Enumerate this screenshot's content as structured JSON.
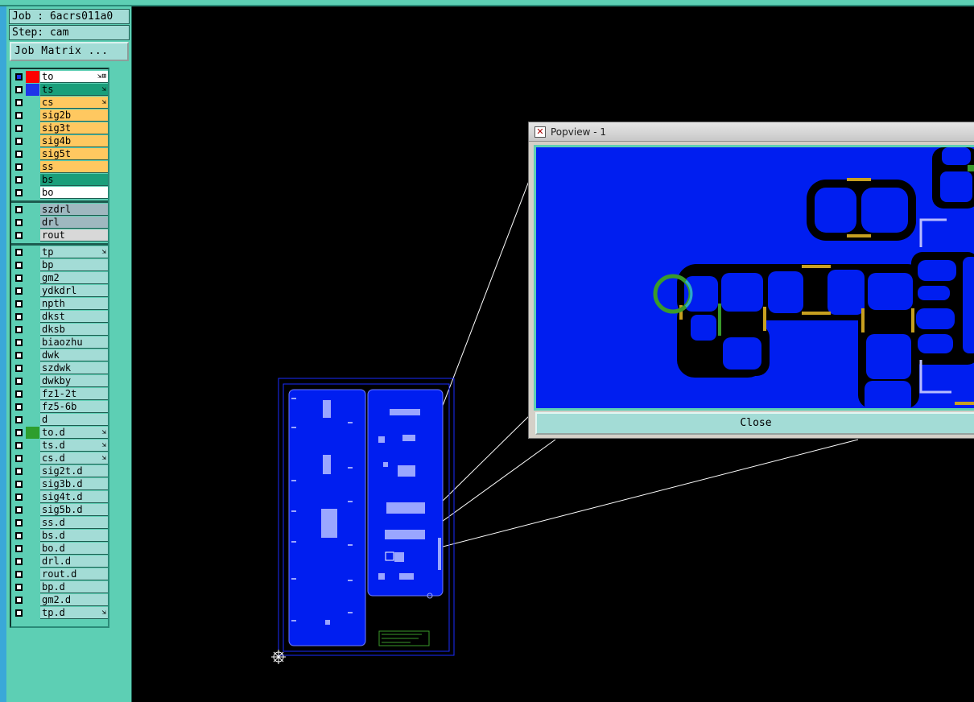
{
  "header": {
    "job_label": "Job : 6acrs011a0",
    "step_label": "Step: cam",
    "job_matrix_label": "Job Matrix ..."
  },
  "layers": [
    {
      "name": "to",
      "color": "#ffffff",
      "swatch": "#ff0000",
      "mark": "⇲⊞",
      "group": 1
    },
    {
      "name": "ts",
      "color": "#1a9e7a",
      "swatch": "#1f34e8",
      "mark": "⇲",
      "group": 1
    },
    {
      "name": "cs",
      "color": "#ffc860",
      "swatch": "",
      "mark": "⇲",
      "group": 1
    },
    {
      "name": "sig2b",
      "color": "#ffc860",
      "swatch": "",
      "mark": "",
      "group": 1
    },
    {
      "name": "sig3t",
      "color": "#ffc860",
      "swatch": "",
      "mark": "",
      "group": 1
    },
    {
      "name": "sig4b",
      "color": "#ffc860",
      "swatch": "",
      "mark": "",
      "group": 1
    },
    {
      "name": "sig5t",
      "color": "#ffc860",
      "swatch": "",
      "mark": "",
      "group": 1
    },
    {
      "name": "ss",
      "color": "#ffc860",
      "swatch": "",
      "mark": "",
      "group": 1
    },
    {
      "name": "bs",
      "color": "#1a9e7a",
      "swatch": "",
      "mark": "",
      "group": 1
    },
    {
      "name": "bo",
      "color": "#ffffff",
      "swatch": "",
      "mark": "",
      "group": 1
    },
    {
      "name": "szdrl",
      "color": "#9fb8c0",
      "swatch": "",
      "mark": "",
      "group": 2
    },
    {
      "name": "drl",
      "color": "#9fb8c0",
      "swatch": "",
      "mark": "",
      "group": 2
    },
    {
      "name": "rout",
      "color": "#d8d8d8",
      "swatch": "",
      "mark": "",
      "group": 2
    },
    {
      "name": "tp",
      "color": "#a3dcd6",
      "swatch": "",
      "mark": "⇲",
      "group": 3
    },
    {
      "name": "bp",
      "color": "#a3dcd6",
      "swatch": "",
      "mark": "",
      "group": 3
    },
    {
      "name": "gm2",
      "color": "#a3dcd6",
      "swatch": "",
      "mark": "",
      "group": 3
    },
    {
      "name": "ydkdrl",
      "color": "#a3dcd6",
      "swatch": "",
      "mark": "",
      "group": 3
    },
    {
      "name": "npth",
      "color": "#a3dcd6",
      "swatch": "",
      "mark": "",
      "group": 3
    },
    {
      "name": "dkst",
      "color": "#a3dcd6",
      "swatch": "",
      "mark": "",
      "group": 3
    },
    {
      "name": "dksb",
      "color": "#a3dcd6",
      "swatch": "",
      "mark": "",
      "group": 3
    },
    {
      "name": "biaozhu",
      "color": "#a3dcd6",
      "swatch": "",
      "mark": "",
      "group": 3
    },
    {
      "name": "dwk",
      "color": "#a3dcd6",
      "swatch": "",
      "mark": "",
      "group": 3
    },
    {
      "name": "szdwk",
      "color": "#a3dcd6",
      "swatch": "",
      "mark": "",
      "group": 3
    },
    {
      "name": "dwkby",
      "color": "#a3dcd6",
      "swatch": "",
      "mark": "",
      "group": 3
    },
    {
      "name": "fz1-2t",
      "color": "#a3dcd6",
      "swatch": "",
      "mark": "",
      "group": 3
    },
    {
      "name": "fz5-6b",
      "color": "#a3dcd6",
      "swatch": "",
      "mark": "",
      "group": 3
    },
    {
      "name": "d",
      "color": "#a3dcd6",
      "swatch": "",
      "mark": "",
      "group": 3
    },
    {
      "name": "to.d",
      "color": "#a3dcd6",
      "swatch": "#2e9e2e",
      "mark": "⇲",
      "group": 3
    },
    {
      "name": "ts.d",
      "color": "#a3dcd6",
      "swatch": "",
      "mark": "⇲",
      "group": 3
    },
    {
      "name": "cs.d",
      "color": "#a3dcd6",
      "swatch": "",
      "mark": "⇲",
      "group": 3
    },
    {
      "name": "sig2t.d",
      "color": "#a3dcd6",
      "swatch": "",
      "mark": "",
      "group": 3
    },
    {
      "name": "sig3b.d",
      "color": "#a3dcd6",
      "swatch": "",
      "mark": "",
      "group": 3
    },
    {
      "name": "sig4t.d",
      "color": "#a3dcd6",
      "swatch": "",
      "mark": "",
      "group": 3
    },
    {
      "name": "sig5b.d",
      "color": "#a3dcd6",
      "swatch": "",
      "mark": "",
      "group": 3
    },
    {
      "name": "ss.d",
      "color": "#a3dcd6",
      "swatch": "",
      "mark": "",
      "group": 3
    },
    {
      "name": "bs.d",
      "color": "#a3dcd6",
      "swatch": "",
      "mark": "",
      "group": 3
    },
    {
      "name": "bo.d",
      "color": "#a3dcd6",
      "swatch": "",
      "mark": "",
      "group": 3
    },
    {
      "name": "drl.d",
      "color": "#a3dcd6",
      "swatch": "",
      "mark": "",
      "group": 3
    },
    {
      "name": "rout.d",
      "color": "#a3dcd6",
      "swatch": "",
      "mark": "",
      "group": 3
    },
    {
      "name": "bp.d",
      "color": "#a3dcd6",
      "swatch": "",
      "mark": "",
      "group": 3
    },
    {
      "name": "gm2.d",
      "color": "#a3dcd6",
      "swatch": "",
      "mark": "",
      "group": 3
    },
    {
      "name": "tp.d",
      "color": "#a3dcd6",
      "swatch": "",
      "mark": "⇲",
      "group": 3
    }
  ],
  "popview": {
    "title": "Popview - 1",
    "close_label": "Close"
  },
  "colors": {
    "panel": "#5dcfb4",
    "copper_fill": "#001ef0",
    "outline": "#1a2cff",
    "pad_gold": "#c8a020",
    "ring_green": "#3a9a2a"
  },
  "icons": {
    "origin": "origin-crosshair-icon",
    "window": "window-app-icon"
  }
}
